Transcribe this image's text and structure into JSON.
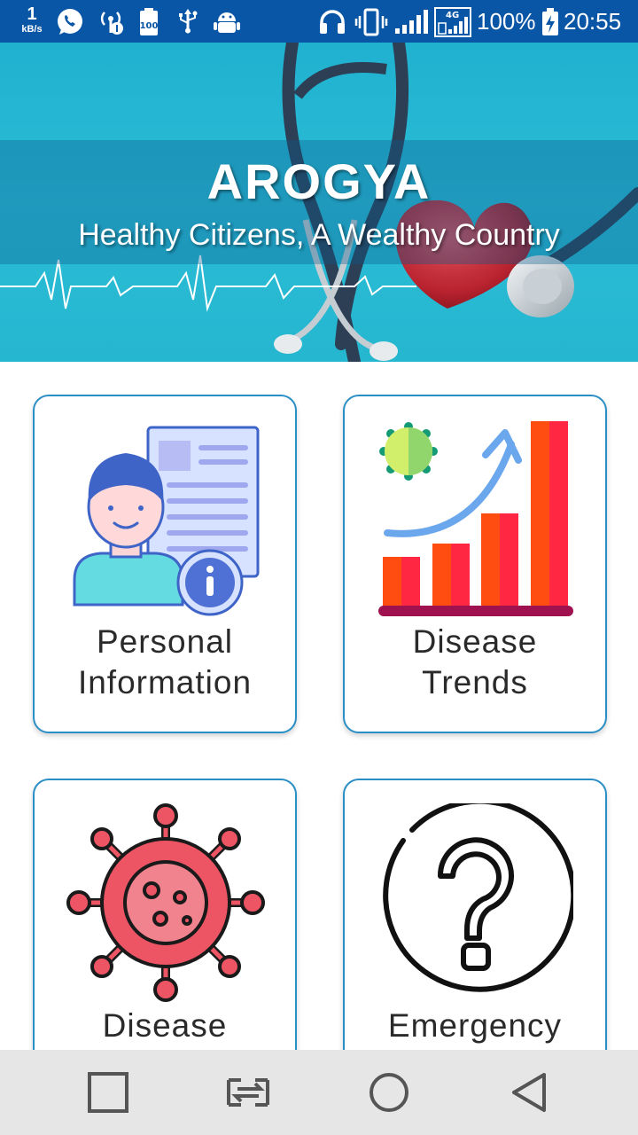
{
  "status_bar": {
    "net_speed_value": "1",
    "net_speed_unit": "kB/s",
    "battery": "100%",
    "time": "20:55",
    "network_type": "4G",
    "icons": [
      "whatsapp-icon",
      "hotspot-icon",
      "battery-saver-icon",
      "usb-icon",
      "android-debug-icon",
      "headphones-icon",
      "vibrate-icon",
      "signal-icon",
      "signal-4g-icon",
      "battery-icon"
    ]
  },
  "banner": {
    "title": "AROGYA",
    "subtitle": "Healthy Citizens, A Wealthy Country"
  },
  "cards": [
    {
      "line1": "Personal",
      "line2": "Information",
      "icon": "personal-info-icon"
    },
    {
      "line1": "Disease",
      "line2": "Trends",
      "icon": "trend-chart-icon"
    },
    {
      "line1": "Disease",
      "line2": "",
      "icon": "virus-icon"
    },
    {
      "line1": "Emergency",
      "line2": "",
      "icon": "question-mark-icon"
    }
  ],
  "nav": {
    "icons": [
      "recent-apps-icon",
      "switch-app-icon",
      "home-icon",
      "back-icon"
    ]
  },
  "colors": {
    "status_bar": "#0a56a6",
    "banner": "#25b6d0",
    "card_border": "#2a8fc6",
    "nav_bar": "#e6e6e6"
  }
}
